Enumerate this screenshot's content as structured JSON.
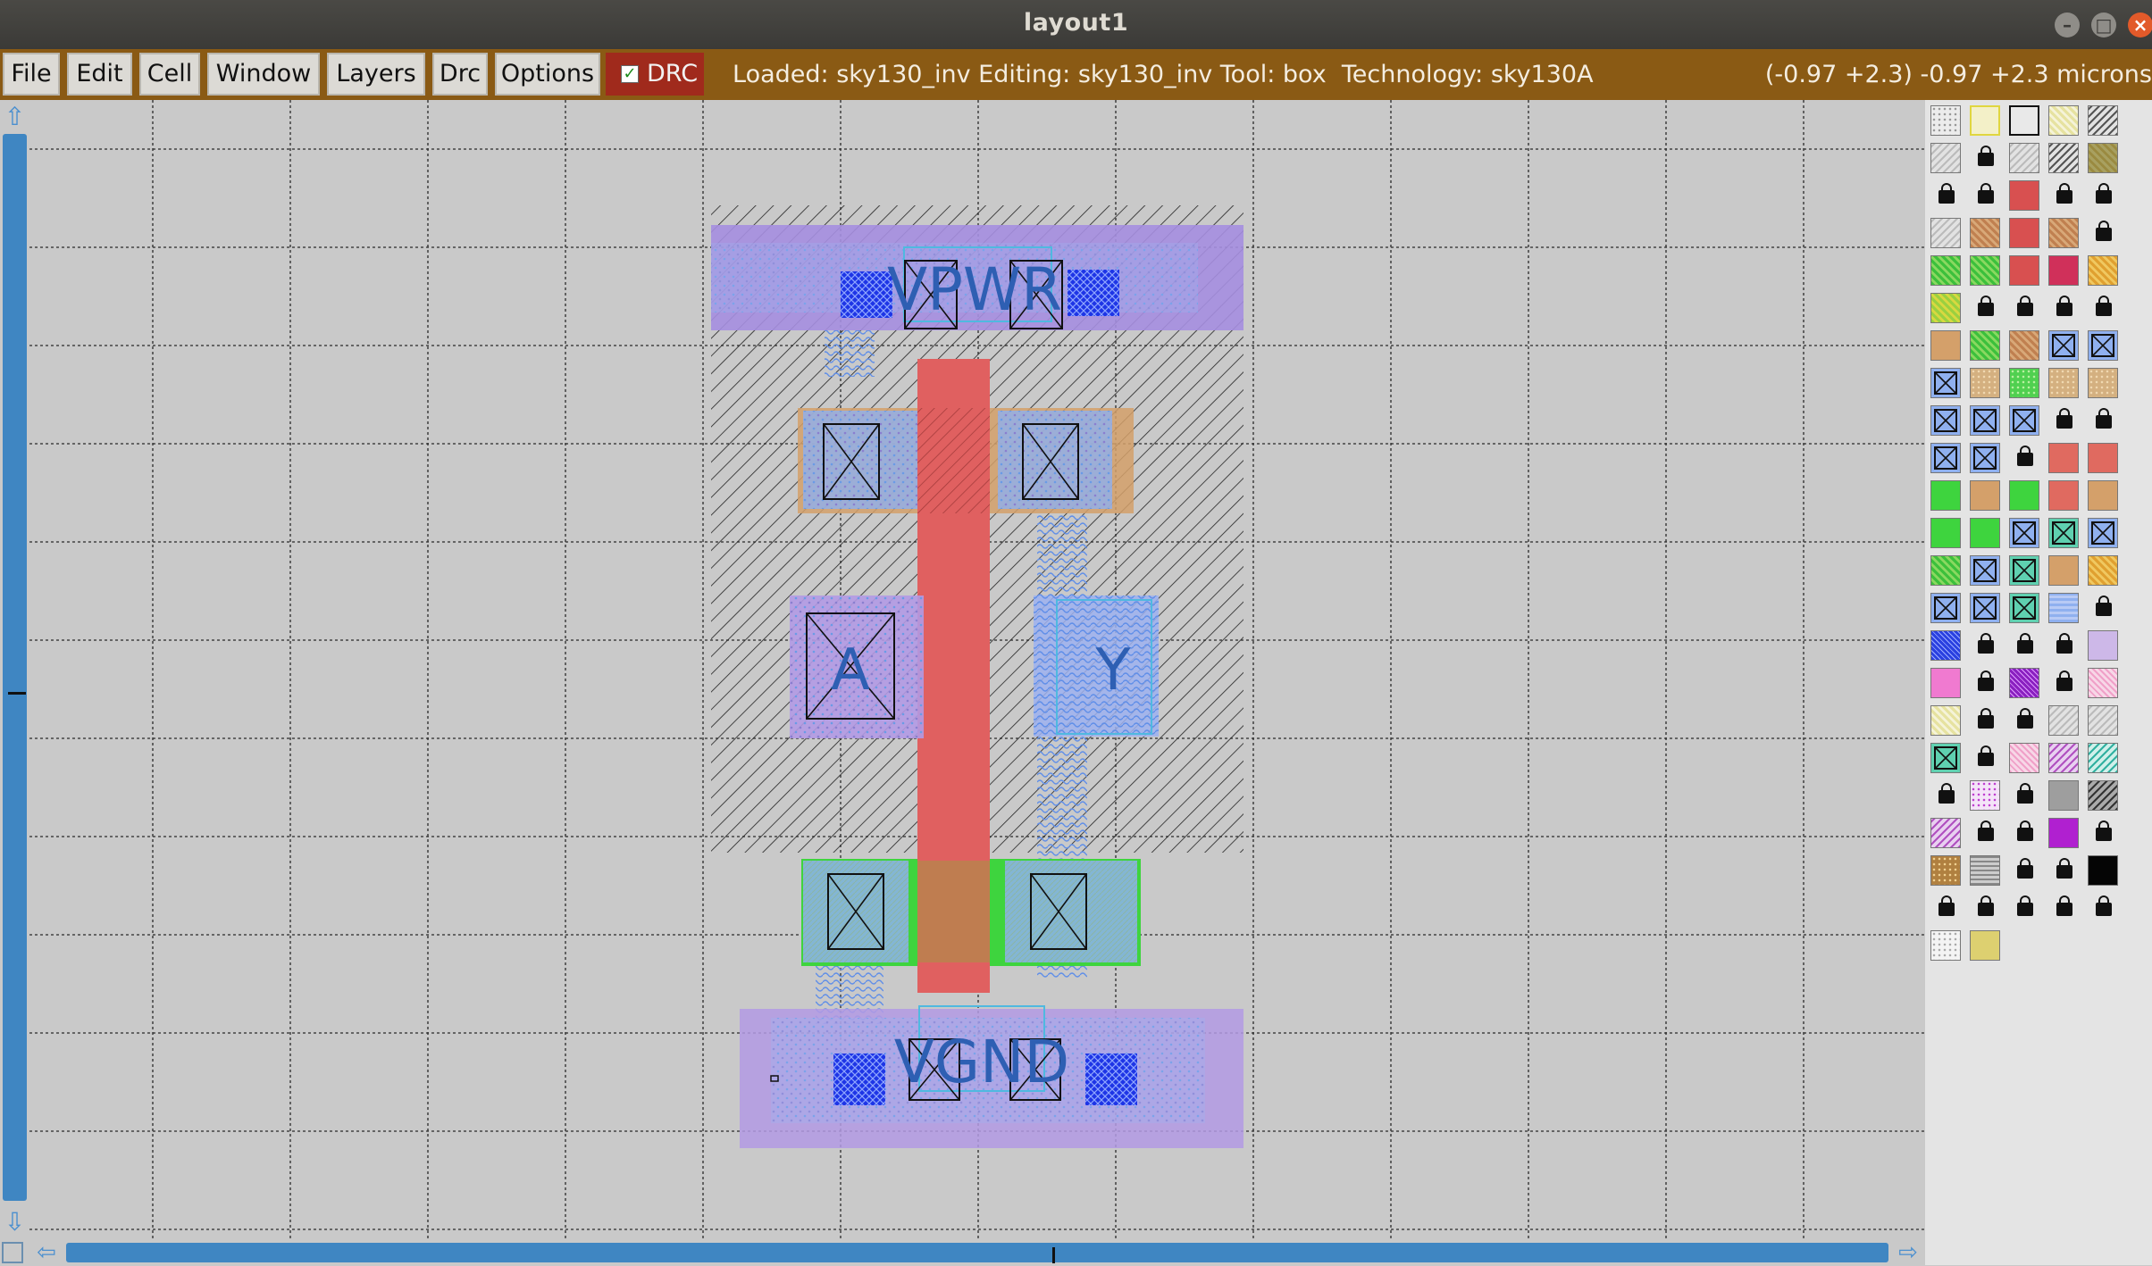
{
  "window": {
    "title": "layout1",
    "controls": {
      "minimize": "–",
      "maximize": "□",
      "close": "×"
    }
  },
  "menubar": {
    "items": [
      "File",
      "Edit",
      "Cell",
      "Window",
      "Layers",
      "Drc",
      "Options"
    ],
    "drc_toggle_label": "DRC",
    "drc_checked": true,
    "status": "Loaded: sky130_inv Editing: sky130_inv Tool: box  Technology: sky130A",
    "coordinates": "(-0.97 +2.3) -0.97 +2.3 microns"
  },
  "layout": {
    "cell": "sky130_inv",
    "labels": {
      "vpwr": "VPWR",
      "vgnd": "VGND",
      "input": "A",
      "output": "Y"
    }
  },
  "colors": {
    "menubar_bg": "#8a5a14",
    "drc_bg": "#a02a1c",
    "poly": "#e06060",
    "locali": "#8fb0ef",
    "diffusion_n": "#3ed43e",
    "diffusion_p": "#d4a06a",
    "nwell_metal": "#a58ee0",
    "pin_label": "#2e5fb3"
  },
  "palette": {
    "swatches": [
      "dots-gray",
      "yellow-outline",
      "black-outline",
      "yellow-hatch",
      "gray-hatch",
      "gray-hatch",
      "gray-light",
      "lock",
      "gray-light",
      "gray-hatch",
      "olive-hatch",
      "lock",
      "lock",
      "lock",
      "red",
      "lock",
      "lock",
      "lock",
      "gray-light",
      "tan-hatch",
      "red",
      "tan-hatch",
      "lock",
      "lock",
      "green-hatch",
      "green-hatch",
      "red",
      "crimson",
      "orange-hatch",
      "green-hatch",
      "yellow-green-hatch",
      "lock",
      "lock",
      "lock",
      "lock",
      "green",
      "tan",
      "green-hatch",
      "tan-hatch",
      "xbox-blue",
      "xbox-blue",
      "xbox-blue",
      "xbox-blue",
      "tan-dots",
      "green-dots",
      "tan-dots",
      "tan-dots",
      "xbox-blue",
      "xbox-blue",
      "xbox-blue",
      "xbox-blue",
      "lock",
      "lock",
      "red",
      "xbox-blue",
      "xbox-blue",
      "lock",
      "salmon",
      "salmon",
      "red",
      "green",
      "tan",
      "green",
      "salmon",
      "tan",
      "salmon",
      "green",
      "green",
      "xbox-blue",
      "xbox-teal",
      "xbox-blue",
      "tan",
      "green-hatch",
      "xbox-blue",
      "xbox-teal",
      "tan",
      "orange-hatch",
      "green",
      "xbox-blue",
      "xbox-blue",
      "xbox-teal",
      "light-blue",
      "lock",
      "light-blue",
      "blue-grid",
      "lock",
      "lock",
      "lock",
      "lavender",
      "lavender",
      "pink",
      "lock",
      "purple-grid",
      "lock",
      "pink-hatch",
      "lock",
      "yellow-hatch",
      "lock",
      "lock",
      "gray-light",
      "gray-light",
      "lock",
      "xbox-teal",
      "lock",
      "pink-hatch",
      "purple-hatch",
      "teal-hatch",
      "teal-hatch",
      "lock",
      "purple-dots",
      "lock",
      "gray",
      "dark-hatch",
      "purple-hatch",
      "purple-hatch",
      "lock",
      "lock",
      "magenta",
      "lock",
      "lock",
      "brown-dots",
      "gray-wave",
      "lock",
      "lock",
      "black",
      "lock",
      "lock",
      "lock",
      "lock",
      "lock",
      "lock",
      "gray-hatch",
      "white-dots",
      "yellow"
    ]
  }
}
